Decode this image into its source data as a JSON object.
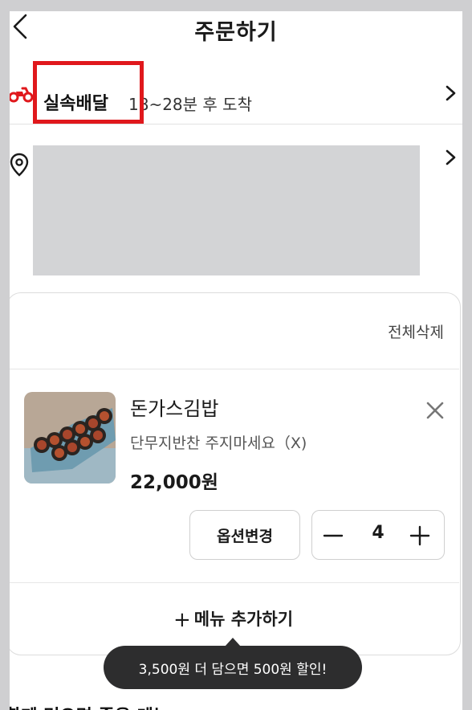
{
  "header": {
    "title": "주문하기",
    "back_icon": "back-arrow-icon"
  },
  "delivery": {
    "type": "실속배달",
    "eta": "18~28분 후 도착",
    "icon": "scooter-icon",
    "highlight_color": "#e0181c"
  },
  "address": {
    "icon": "location-pin-icon",
    "value_redacted": true
  },
  "cart": {
    "delete_all_label": "전체삭제",
    "items": [
      {
        "name": "돈가스김밥",
        "option": "단무지반찬 주지마세요（X)",
        "price": "22,000원",
        "quantity": "4",
        "change_option_label": "옵션변경",
        "image": "donkatsu-gimbap-photo"
      }
    ],
    "add_menu_label": "메뉴 추가하기",
    "add_menu_plus": "+"
  },
  "tooltip": {
    "text": "3,500원 더 담으면 500원 할인!"
  },
  "bottom_section": {
    "title": "함께 먹으면 좋은 메뉴"
  },
  "colors": {
    "accent_red": "#e0181c",
    "tooltip_bg": "#2d2d2e",
    "redaction_gray": "#d3d4d6"
  }
}
